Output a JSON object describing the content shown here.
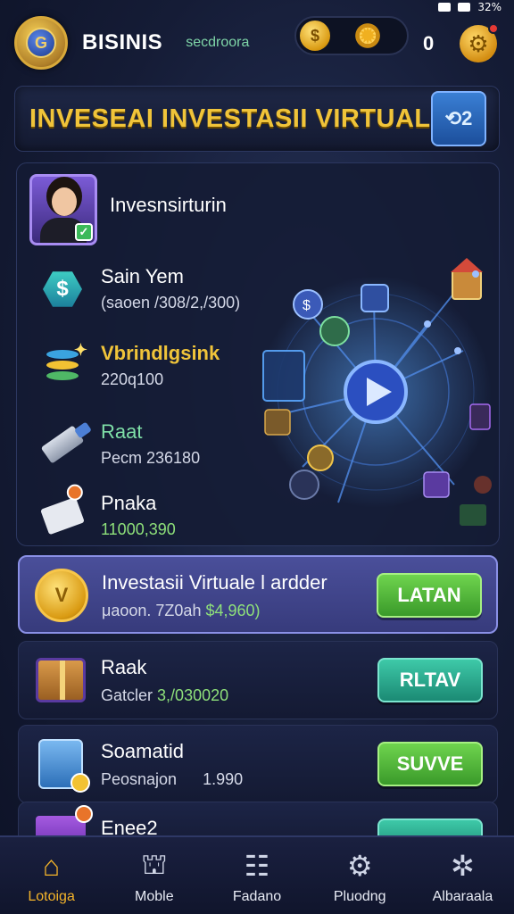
{
  "status_bar": {
    "battery": "32%"
  },
  "header": {
    "brand": "BISINIS",
    "subtitle": "secdroora",
    "coin_count": "0"
  },
  "banner": {
    "title": "INVESEAI INVESTASII VIRTUAL",
    "chat_label": "2"
  },
  "profile": {
    "name": "Invesnsirturin"
  },
  "stats": [
    {
      "label": "Sain Yem",
      "value": "(sаoen /308/2,/300)",
      "icon": "dollar-hex-icon"
    },
    {
      "label": "Vbrindlgsink",
      "value": "220q100",
      "icon": "coin-stack-icon"
    },
    {
      "label": "Raat",
      "value": "Pecm 236180",
      "icon": "tool-icon"
    },
    {
      "label": "Pnaka",
      "value": "11000,390",
      "icon": "document-icon"
    }
  ],
  "investments": [
    {
      "name": "Investasii Virtuale l ardder",
      "detail_prefix": "μaoon. 7Z0ah",
      "detail_value": "$4,960)",
      "button": "LATAN",
      "highlight": true
    },
    {
      "name": "Raak",
      "detail_prefix": "Gatcler",
      "detail_value": "3,/030020",
      "button": "RLTAV"
    },
    {
      "name": "Soamatid",
      "detail_prefix": "Peosnajon",
      "detail_value": "1.990",
      "button": "SUVVE"
    },
    {
      "name": "Enee2",
      "detail_prefix": "",
      "detail_value": "",
      "button": ""
    }
  ],
  "nav": [
    {
      "label": "Lotoiga",
      "icon": "home-icon",
      "active": true
    },
    {
      "label": "Moble",
      "icon": "school-icon"
    },
    {
      "label": "Fadano",
      "icon": "ledger-icon"
    },
    {
      "label": "Pluodng",
      "icon": "gear-plug-icon"
    },
    {
      "label": "Albaraala",
      "icon": "settings-icon"
    }
  ]
}
